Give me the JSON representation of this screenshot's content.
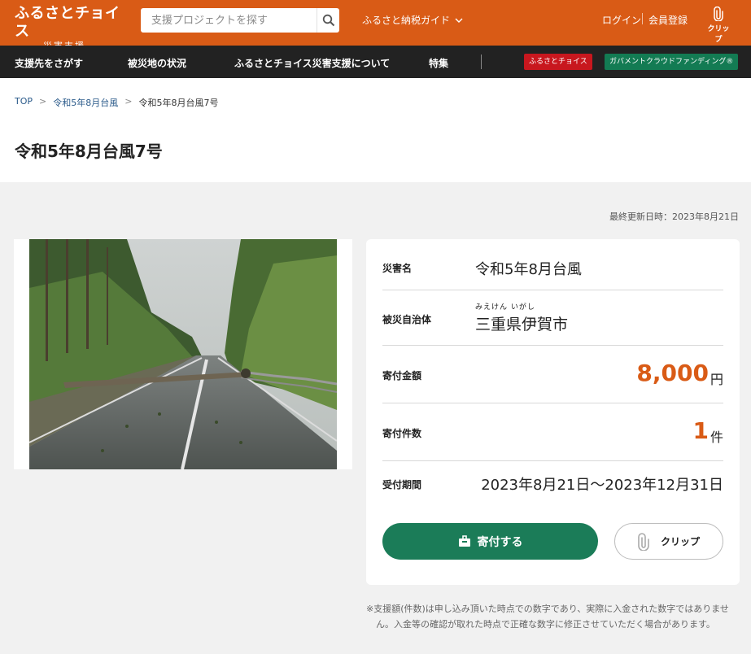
{
  "header": {
    "logo_main": "ふるさとチョイス",
    "logo_sub": "災害支援",
    "search_placeholder": "支援プロジェクトを探す",
    "guide_label": "ふるさと納税ガイド",
    "login_label": "ログイン",
    "register_label": "会員登録",
    "clip_label": "クリップ"
  },
  "nav": {
    "items": [
      "支援先をさがす",
      "被災地の状況",
      "ふるさとチョイス災害支援について",
      "特集"
    ],
    "badge_choice": "ふるさとチョイス",
    "badge_gcf": "ガバメントクラウドファンディング®",
    "badge_choice_color": "#c8171e",
    "badge_gcf_color": "#137b53"
  },
  "breadcrumb": {
    "top": "TOP",
    "parent": "令和5年8月台風",
    "current": "令和5年8月台風7号",
    "separator": ">"
  },
  "page_title": "令和5年8月台風7号",
  "updated": "最終更新日時：2023年8月21日",
  "info": {
    "disaster_label": "災害名",
    "disaster_value": "令和5年8月台風",
    "municipality_label": "被災自治体",
    "municipality_ruby": "みえけん いがし",
    "municipality_value": "三重県伊賀市",
    "amount_label": "寄付金額",
    "amount_value": "8,000",
    "amount_unit": "円",
    "count_label": "寄付件数",
    "count_value": "1",
    "count_unit": "件",
    "period_label": "受付期間",
    "period_value": "2023年8月21日～2023年12月31日"
  },
  "actions": {
    "donate_label": "寄付する",
    "clip_label": "クリップ"
  },
  "note": "※支援額(件数)は申し込み頂いた時点での数字であり、実際に入金された数字ではありません。入金等の確認が取れた時点で正確な数字に修正させていただく場合があります。",
  "colors": {
    "brand_orange": "#d95b16",
    "nav_dark": "#222222",
    "donate_green": "#1b7c58"
  }
}
